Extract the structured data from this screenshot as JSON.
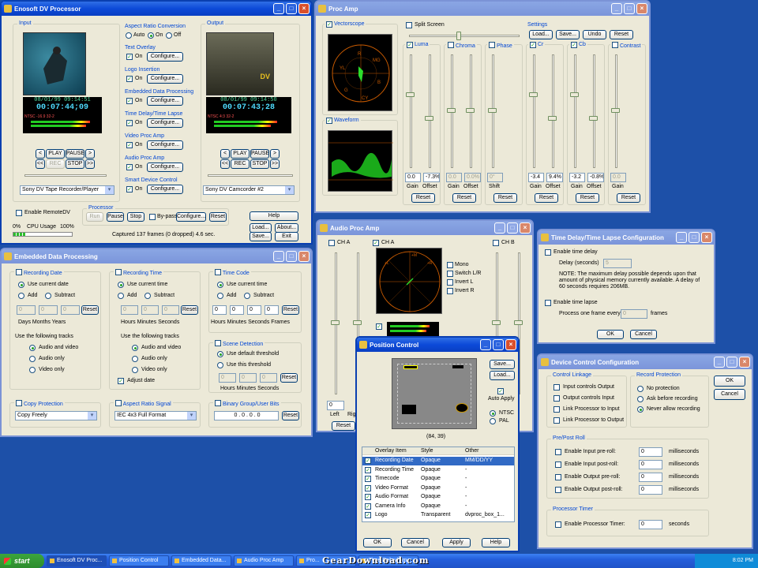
{
  "dv": {
    "title": "Enosoft DV Processor",
    "input_label": "Input",
    "output_label": "Output",
    "in_date": "08/01/99 09:14:51",
    "in_tc": "00:07:44;09",
    "in_info": "NTSC    -16.9  32-2",
    "out_date": "08/01/99 09:14:50",
    "out_tc": "00:07:43;28",
    "out_info": "NTSC    4:3   32-2",
    "transport": {
      "prev": "<",
      "play": "PLAY",
      "pause": "PAUSE",
      "next": ">",
      "rew": "<<",
      "rec": "REC",
      "stop": "STOP",
      "ffwd": ">>"
    },
    "in_device": "Sony DV Tape Recorder/Player",
    "out_device": "Sony DV Camcorder #2",
    "aspect": {
      "label": "Aspect Ratio Conversion",
      "auto": "Auto",
      "on": "On",
      "off": "Off"
    },
    "features": [
      {
        "label": "Text Overlay",
        "on": "On",
        "btn": "Configure..."
      },
      {
        "label": "Logo Insertion",
        "on": "On",
        "btn": "Configure..."
      },
      {
        "label": "Embedded Data Processing",
        "on": "On",
        "btn": "Configure..."
      },
      {
        "label": "Time Delay/Time Lapse",
        "on": "On",
        "btn": "Configure..."
      },
      {
        "label": "Video Proc Amp",
        "on": "On",
        "btn": "Configure..."
      },
      {
        "label": "Audio Proc Amp",
        "on": "On",
        "btn": "Configure..."
      },
      {
        "label": "Smart Device Control",
        "on": "On",
        "btn": "Configure..."
      }
    ],
    "processor": {
      "label": "Processor",
      "run": "Run",
      "pause": "Pause",
      "stop": "Stop",
      "bypass": "By-pass",
      "configure": "Configure...",
      "reset": "Reset"
    },
    "remote": "Enable RemoteDV",
    "cpu_lo": "0%",
    "cpu_label": "CPU Usage",
    "cpu_hi": "100%",
    "cpu_usage": 0.2,
    "captured": "Captured 137 frames (0 dropped) 4.6 sec.",
    "help": "Help",
    "load": "Load...",
    "about": "About...",
    "save": "Save...",
    "exit": "Exit"
  },
  "proc": {
    "title": "Proc Amp",
    "vectorscope": "Vectorscope",
    "waveform": "Waveform",
    "split": "Split Screen",
    "settings": "Settings",
    "load": "Load...",
    "save": "Save...",
    "undo": "Undo",
    "reset": "Reset",
    "vs_labels": {
      "r": "R",
      "mg": "MG",
      "yl": "YL",
      "b": "B",
      "g": "G",
      "cy": "CY"
    },
    "channels": [
      {
        "name": "Luma",
        "v1": "0.0",
        "v2": "-7.3%",
        "l1": "Gain",
        "l2": "Offset",
        "reset": "Reset",
        "on": true
      },
      {
        "name": "Chroma",
        "v1": "0.0",
        "v2": "0.0%",
        "l1": "Gain",
        "l2": "Offset",
        "reset": "Reset",
        "on": false
      },
      {
        "name": "Phase",
        "v1": "0°",
        "v2": "",
        "l1": "Shift",
        "l2": "",
        "reset": "Reset",
        "on": false
      },
      {
        "name": "Cr",
        "v1": "-3.4",
        "v2": "9.4%",
        "l1": "Gain",
        "l2": "Offset",
        "reset": "Reset",
        "on": true
      },
      {
        "name": "Cb",
        "v1": "-3.2",
        "v2": "-0.8%",
        "l1": "Gain",
        "l2": "Offset",
        "reset": "Reset",
        "on": true
      },
      {
        "name": "Contrast",
        "v1": "0.0",
        "v2": "",
        "l1": "Gain",
        "l2": "",
        "reset": "Reset",
        "on": false
      }
    ]
  },
  "edp": {
    "title": "Embedded Data Processing",
    "recdate": {
      "label": "Recording Date",
      "use": "Use current date",
      "add": "Add",
      "sub": "Subtract",
      "reset": "Reset",
      "units": "Days   Months   Years"
    },
    "rectime": {
      "label": "Recording Time",
      "use": "Use current time",
      "add": "Add",
      "sub": "Subtract",
      "reset": "Reset",
      "units": "Hours  Minutes  Seconds"
    },
    "timecode": {
      "label": "Time Code",
      "use": "Use current time",
      "add": "Add",
      "sub": "Subtract",
      "reset": "Reset",
      "units": "Hours  Minutes  Seconds  Frames"
    },
    "tracks": "Use the following tracks",
    "audio_video": "Audio and video",
    "audio_only": "Audio only",
    "video_only": "Video only",
    "adjust": "Adjust date",
    "scene": {
      "label": "Scene Detection",
      "default": "Use default threshold",
      "this": "Use this threshold",
      "reset": "Reset",
      "units": "Hours  Minutes  Seconds"
    },
    "copy": {
      "label": "Copy Protection",
      "value": "Copy Freely"
    },
    "aspect": {
      "label": "Aspect Ratio Signal",
      "value": "IEC 4x3 Full Format"
    },
    "binary": {
      "label": "Binary Group/User Bits",
      "value": "0 . 0 . 0 . 0",
      "reset": "Reset"
    },
    "zero": "0"
  },
  "apa": {
    "title": "Audio Proc Amp",
    "cha": "CH A",
    "chb": "CH B",
    "mono": "Mono",
    "switch": "Switch L/R",
    "invl": "Invert L",
    "invr": "Invert R",
    "left": "Left",
    "right": "Rig",
    "reset": "Reset",
    "zero": "0",
    "scope": {
      "l": "+L",
      "r": "+R",
      "m": "+M"
    }
  },
  "pos": {
    "title": "Position Control",
    "save": "Save...",
    "load": "Load...",
    "autoapply": "Auto Apply",
    "ntsc": "NTSC",
    "pal": "PAL",
    "coords": "(84, 39)",
    "cols": [
      "Overlay Item",
      "Style",
      "Other"
    ],
    "rows": [
      {
        "item": "Recording Date",
        "style": "Opaque",
        "other": "MM/DD/YY",
        "sel": true
      },
      {
        "item": "Recording Time",
        "style": "Opaque",
        "other": "-",
        "sel": false
      },
      {
        "item": "Timecode",
        "style": "Opaque",
        "other": "-",
        "sel": false
      },
      {
        "item": "Video Format",
        "style": "Opaque",
        "other": "-",
        "sel": false
      },
      {
        "item": "Audio Format",
        "style": "Opaque",
        "other": "-",
        "sel": false
      },
      {
        "item": "Camera Info",
        "style": "Opaque",
        "other": "-",
        "sel": false
      },
      {
        "item": "Logo",
        "style": "Transparent",
        "other": "dvproc_box_1...",
        "sel": false
      }
    ],
    "ok": "OK",
    "cancel": "Cancel",
    "apply": "Apply",
    "help": "Help"
  },
  "tdc": {
    "title": "Time Delay/Time Lapse Configuration",
    "enable_delay": "Enable time delay",
    "delay_label": "Delay (seconds)",
    "delay_val": "5",
    "note": "NOTE:  The maximum delay possible depends upon that amount of physical memory currently available.  A delay of 60 seconds requires 206MB.",
    "enable_lapse": "Enable time lapse",
    "process": "Process one frame every",
    "lapse_val": "0",
    "frames": "frames",
    "ok": "OK",
    "cancel": "Cancel"
  },
  "dcc": {
    "title": "Device Control Configuration",
    "linkage": "Control Linkage",
    "link_items": [
      "Input controls Output",
      "Output controls Input",
      "Link Processor to Input",
      "Link Processor to Output"
    ],
    "rec_prot": "Record Protection",
    "rec_items": [
      "No protection",
      "Ask before recording",
      "Never allow recording"
    ],
    "ok": "OK",
    "cancel": "Cancel",
    "preroll": "Pre/Post Roll",
    "roll_items": [
      "Enable Input pre-roll:",
      "Enable Input post-roll:",
      "Enable Output pre-roll:",
      "Enable Output post-roll:"
    ],
    "ms": "milliseconds",
    "zero": "0",
    "timer": "Processor Timer",
    "timer_label": "Enable Processor Timer:",
    "seconds": "seconds"
  },
  "taskbar": {
    "start": "start",
    "tasks": [
      "Enosoft DV Proc...",
      "Position Control",
      "Embedded Data...",
      "Audio Proc Amp",
      "Pro...",
      "Time Delay/Tim..."
    ],
    "watermark": "GearDownload.com",
    "clock": "8:02 PM"
  }
}
